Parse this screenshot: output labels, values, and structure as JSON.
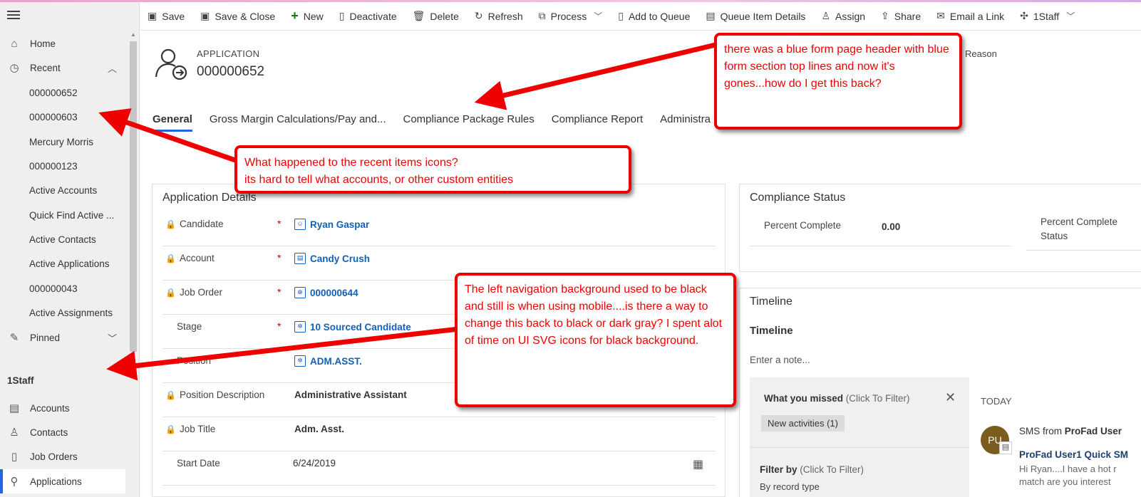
{
  "sidebar": {
    "home": "Home",
    "recent": "Recent",
    "recent_items": [
      "000000652",
      "000000603",
      "Mercury Morris",
      "000000123",
      "Active Accounts",
      "Quick Find Active ...",
      "Active Contacts",
      "Active Applications",
      "000000043",
      "Active Assignments"
    ],
    "pinned": "Pinned",
    "group": "1Staff",
    "entities": [
      "Accounts",
      "Contacts",
      "Job Orders",
      "Applications"
    ]
  },
  "toolbar": {
    "save": "Save",
    "save_close": "Save & Close",
    "new": "New",
    "deactivate": "Deactivate",
    "delete": "Delete",
    "refresh": "Refresh",
    "process": "Process",
    "add_to_queue": "Add to Queue",
    "queue_item_details": "Queue Item Details",
    "assign": "Assign",
    "share": "Share",
    "email_link": "Email a Link",
    "staff": "1Staff"
  },
  "header": {
    "entity_type": "APPLICATION",
    "entity_name": "000000652",
    "status_reason": "Reason"
  },
  "tabs": [
    "General",
    "Gross Margin Calculations/Pay and...",
    "Compliance Package Rules",
    "Compliance Report",
    "Administra"
  ],
  "details": {
    "title": "Application Details",
    "fields": [
      {
        "label": "Candidate",
        "value": "Ryan Gaspar",
        "required": "*"
      },
      {
        "label": "Account",
        "value": "Candy Crush",
        "required": "*"
      },
      {
        "label": "Job Order",
        "value": "000000644",
        "required": "*"
      },
      {
        "label": "Stage",
        "value": "10 Sourced Candidate",
        "required": "*"
      },
      {
        "label": "Position",
        "value": "ADM.ASST.",
        "required": ""
      },
      {
        "label": "Position Description",
        "value": "Administrative Assistant",
        "required": ""
      },
      {
        "label": "Job Title",
        "value": "Adm. Asst.",
        "required": ""
      },
      {
        "label": "Start Date",
        "value": "6/24/2019",
        "required": ""
      }
    ]
  },
  "compliance": {
    "title": "Compliance Status",
    "percent_label": "Percent Complete",
    "percent_value": "0.00",
    "status_label_1": "Percent Complete",
    "status_label_2": "Status"
  },
  "timeline": {
    "section_title": "Timeline",
    "title": "Timeline",
    "note_placeholder": "Enter a note...",
    "missed_label": "What you missed",
    "missed_hint": "(Click To Filter)",
    "new_activities": "New activities (1)",
    "filter_label": "Filter by",
    "filter_hint": "(Click To Filter)",
    "record_type": "By record type",
    "today": "TODAY",
    "avatar_initials": "PU",
    "sms_prefix": "SMS from",
    "sms_sender": "ProFad User",
    "quick_title": "ProFad User1 Quick SM",
    "msg_line1": "Hi Ryan....I have a hot r",
    "msg_line2": "match are you interest"
  },
  "annotations": {
    "header_note": "there was a blue form page header with blue form section top lines and now it's gones...how do I get this back?",
    "recent_note_1": "What happened to the recent items icons?",
    "recent_note_2": "its hard to tell what accounts, or other custom entities",
    "nav_note": "The left navigation background used to be black and still is when using mobile....is there a way to change this back to black or dark gray? I spent alot of time on UI SVG icons for black background."
  },
  "colors": {
    "accent": "#2266e3",
    "link": "#1160b7",
    "annotation": "#e00000",
    "required": "#cc0000"
  }
}
